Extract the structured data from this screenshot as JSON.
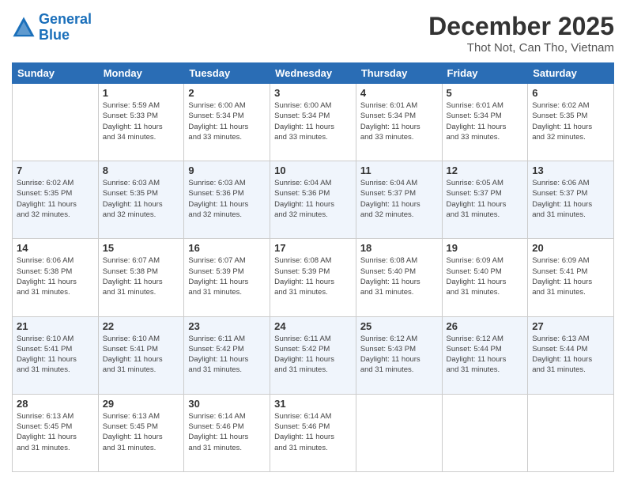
{
  "header": {
    "logo_line1": "General",
    "logo_line2": "Blue",
    "month": "December 2025",
    "location": "Thot Not, Can Tho, Vietnam"
  },
  "days_of_week": [
    "Sunday",
    "Monday",
    "Tuesday",
    "Wednesday",
    "Thursday",
    "Friday",
    "Saturday"
  ],
  "weeks": [
    [
      {
        "day": "",
        "info": ""
      },
      {
        "day": "1",
        "info": "Sunrise: 5:59 AM\nSunset: 5:33 PM\nDaylight: 11 hours\nand 34 minutes."
      },
      {
        "day": "2",
        "info": "Sunrise: 6:00 AM\nSunset: 5:34 PM\nDaylight: 11 hours\nand 33 minutes."
      },
      {
        "day": "3",
        "info": "Sunrise: 6:00 AM\nSunset: 5:34 PM\nDaylight: 11 hours\nand 33 minutes."
      },
      {
        "day": "4",
        "info": "Sunrise: 6:01 AM\nSunset: 5:34 PM\nDaylight: 11 hours\nand 33 minutes."
      },
      {
        "day": "5",
        "info": "Sunrise: 6:01 AM\nSunset: 5:34 PM\nDaylight: 11 hours\nand 33 minutes."
      },
      {
        "day": "6",
        "info": "Sunrise: 6:02 AM\nSunset: 5:35 PM\nDaylight: 11 hours\nand 32 minutes."
      }
    ],
    [
      {
        "day": "7",
        "info": "Sunrise: 6:02 AM\nSunset: 5:35 PM\nDaylight: 11 hours\nand 32 minutes."
      },
      {
        "day": "8",
        "info": "Sunrise: 6:03 AM\nSunset: 5:35 PM\nDaylight: 11 hours\nand 32 minutes."
      },
      {
        "day": "9",
        "info": "Sunrise: 6:03 AM\nSunset: 5:36 PM\nDaylight: 11 hours\nand 32 minutes."
      },
      {
        "day": "10",
        "info": "Sunrise: 6:04 AM\nSunset: 5:36 PM\nDaylight: 11 hours\nand 32 minutes."
      },
      {
        "day": "11",
        "info": "Sunrise: 6:04 AM\nSunset: 5:37 PM\nDaylight: 11 hours\nand 32 minutes."
      },
      {
        "day": "12",
        "info": "Sunrise: 6:05 AM\nSunset: 5:37 PM\nDaylight: 11 hours\nand 31 minutes."
      },
      {
        "day": "13",
        "info": "Sunrise: 6:06 AM\nSunset: 5:37 PM\nDaylight: 11 hours\nand 31 minutes."
      }
    ],
    [
      {
        "day": "14",
        "info": "Sunrise: 6:06 AM\nSunset: 5:38 PM\nDaylight: 11 hours\nand 31 minutes."
      },
      {
        "day": "15",
        "info": "Sunrise: 6:07 AM\nSunset: 5:38 PM\nDaylight: 11 hours\nand 31 minutes."
      },
      {
        "day": "16",
        "info": "Sunrise: 6:07 AM\nSunset: 5:39 PM\nDaylight: 11 hours\nand 31 minutes."
      },
      {
        "day": "17",
        "info": "Sunrise: 6:08 AM\nSunset: 5:39 PM\nDaylight: 11 hours\nand 31 minutes."
      },
      {
        "day": "18",
        "info": "Sunrise: 6:08 AM\nSunset: 5:40 PM\nDaylight: 11 hours\nand 31 minutes."
      },
      {
        "day": "19",
        "info": "Sunrise: 6:09 AM\nSunset: 5:40 PM\nDaylight: 11 hours\nand 31 minutes."
      },
      {
        "day": "20",
        "info": "Sunrise: 6:09 AM\nSunset: 5:41 PM\nDaylight: 11 hours\nand 31 minutes."
      }
    ],
    [
      {
        "day": "21",
        "info": "Sunrise: 6:10 AM\nSunset: 5:41 PM\nDaylight: 11 hours\nand 31 minutes."
      },
      {
        "day": "22",
        "info": "Sunrise: 6:10 AM\nSunset: 5:41 PM\nDaylight: 11 hours\nand 31 minutes."
      },
      {
        "day": "23",
        "info": "Sunrise: 6:11 AM\nSunset: 5:42 PM\nDaylight: 11 hours\nand 31 minutes."
      },
      {
        "day": "24",
        "info": "Sunrise: 6:11 AM\nSunset: 5:42 PM\nDaylight: 11 hours\nand 31 minutes."
      },
      {
        "day": "25",
        "info": "Sunrise: 6:12 AM\nSunset: 5:43 PM\nDaylight: 11 hours\nand 31 minutes."
      },
      {
        "day": "26",
        "info": "Sunrise: 6:12 AM\nSunset: 5:44 PM\nDaylight: 11 hours\nand 31 minutes."
      },
      {
        "day": "27",
        "info": "Sunrise: 6:13 AM\nSunset: 5:44 PM\nDaylight: 11 hours\nand 31 minutes."
      }
    ],
    [
      {
        "day": "28",
        "info": "Sunrise: 6:13 AM\nSunset: 5:45 PM\nDaylight: 11 hours\nand 31 minutes."
      },
      {
        "day": "29",
        "info": "Sunrise: 6:13 AM\nSunset: 5:45 PM\nDaylight: 11 hours\nand 31 minutes."
      },
      {
        "day": "30",
        "info": "Sunrise: 6:14 AM\nSunset: 5:46 PM\nDaylight: 11 hours\nand 31 minutes."
      },
      {
        "day": "31",
        "info": "Sunrise: 6:14 AM\nSunset: 5:46 PM\nDaylight: 11 hours\nand 31 minutes."
      },
      {
        "day": "",
        "info": ""
      },
      {
        "day": "",
        "info": ""
      },
      {
        "day": "",
        "info": ""
      }
    ]
  ]
}
